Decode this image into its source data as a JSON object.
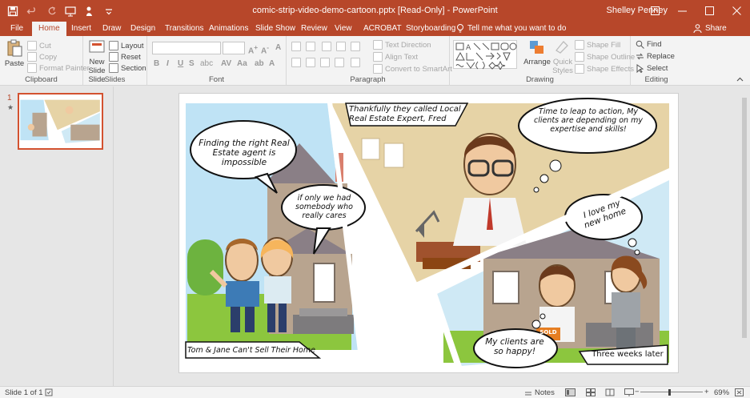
{
  "window": {
    "title": "comic-strip-video-demo-cartoon.pptx [Read-Only]  -  PowerPoint",
    "user": "Shelley Penney"
  },
  "tabs": [
    "File",
    "Home",
    "Insert",
    "Draw",
    "Design",
    "Transitions",
    "Animations",
    "Slide Show",
    "Review",
    "View",
    "ACROBAT",
    "Storyboarding"
  ],
  "active_tab": "Home",
  "tell_me": "Tell me what you want to do",
  "share": "Share",
  "ribbon": {
    "clipboard": {
      "label": "Clipboard",
      "paste": "Paste",
      "cut": "Cut",
      "copy": "Copy",
      "format_painter": "Format Painter"
    },
    "slides": {
      "label": "Slides",
      "new_slide": "New Slide",
      "new_slide_2": "Slide",
      "layout": "Layout",
      "reset": "Reset",
      "section": "Section"
    },
    "font": {
      "label": "Font",
      "bold": "B",
      "italic": "I",
      "underline": "U",
      "strike": "S",
      "shadow": "abc"
    },
    "paragraph": {
      "label": "Paragraph",
      "text_direction": "Text Direction",
      "align_text": "Align Text",
      "smartart": "Convert to SmartArt"
    },
    "drawing": {
      "label": "Drawing",
      "arrange": "Arrange",
      "quick_styles": "Quick",
      "quick_styles_2": "Styles",
      "shape_fill": "Shape Fill",
      "shape_outline": "Shape Outline",
      "shape_effects": "Shape Effects"
    },
    "editing": {
      "label": "Editing",
      "find": "Find",
      "replace": "Replace",
      "select": "Select"
    }
  },
  "thumbnails": {
    "number": "1",
    "star": "★"
  },
  "slide": {
    "bubble1": "Finding the right Real Estate agent is impossible",
    "bubble2": "if only we had somebody who really cares",
    "caption1": "Thankfully they called Local Real Estate Expert, Fred",
    "bubble3": "Time to leap to action, My clients are depending on my expertise and skills!",
    "bubble4": "I love my new home",
    "caption_tom": "Tom & Jane Can't Sell Their Home",
    "bubble5": "My clients are so happy!",
    "caption_weeks": "Three weeks later",
    "sold_sign": "SOLD"
  },
  "status": {
    "slide_of": "Slide 1 of 1",
    "notes": "Notes",
    "zoom": "69%"
  },
  "colors": {
    "accent": "#b7472a",
    "ribbon_bg": "#f3f3f3",
    "sky": "#bfe3f5",
    "grass": "#8cc63e"
  }
}
